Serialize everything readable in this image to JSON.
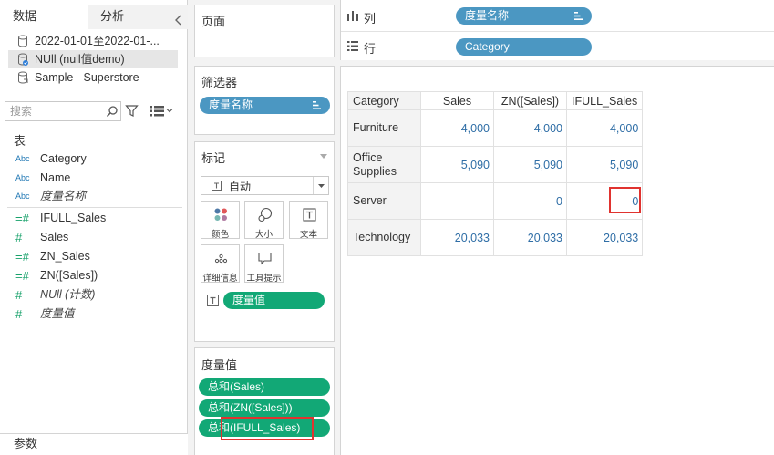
{
  "data_pane": {
    "tabs": {
      "data": "数据",
      "analysis": "分析"
    },
    "datasources": [
      {
        "label": "2022-01-01至2022-01-..."
      },
      {
        "label": "NUll (null值demo)"
      },
      {
        "label": "Sample - Superstore"
      }
    ],
    "search": {
      "placeholder": "搜索"
    },
    "tables_header": "表",
    "fields": [
      {
        "type": "Abc",
        "label": "Category"
      },
      {
        "type": "Abc",
        "label": "Name"
      },
      {
        "type": "Abc",
        "label": "度量名称"
      },
      {
        "type": "=#",
        "label": "IFULL_Sales"
      },
      {
        "type": "#",
        "label": "Sales"
      },
      {
        "type": "=#",
        "label": "ZN_Sales"
      },
      {
        "type": "=#",
        "label": "ZN([Sales])"
      },
      {
        "type": "#",
        "label": "NUll (计数)"
      },
      {
        "type": "#",
        "label": "度量值"
      }
    ],
    "params_header": "参数"
  },
  "pages_card": {
    "title": "页面"
  },
  "filters_card": {
    "title": "筛选器",
    "pill": "度量名称"
  },
  "marks_card": {
    "title": "标记",
    "mark_type": "自动",
    "buttons": {
      "color": "颜色",
      "size": "大小",
      "text": "文本",
      "detail": "详细信息",
      "tooltip": "工具提示"
    },
    "text_pill": "度量值"
  },
  "measure_values_card": {
    "title": "度量值",
    "pills": [
      "总和(Sales)",
      "总和(ZN([Sales]))",
      "总和(IFULL_Sales)"
    ]
  },
  "shelves": {
    "columns": {
      "label": "列",
      "pill": "度量名称"
    },
    "rows": {
      "label": "行",
      "pill": "Category"
    }
  },
  "crosstab": {
    "headers": [
      "Category",
      "Sales",
      "ZN([Sales])",
      "IFULL_Sales"
    ],
    "rows": [
      {
        "category": "Furniture",
        "values": [
          "4,000",
          "4,000",
          "4,000"
        ]
      },
      {
        "category": "Office Supplies",
        "values": [
          "5,090",
          "5,090",
          "5,090"
        ]
      },
      {
        "category": "Server",
        "values": [
          "",
          "0",
          "0"
        ]
      },
      {
        "category": "Technology",
        "values": [
          "20,033",
          "20,033",
          "20,033"
        ]
      }
    ]
  },
  "colors": {
    "pill_blue": "#4b97c2",
    "pill_green": "#12a876",
    "value_text": "#2f6ea6",
    "highlight": "#e0332f"
  }
}
